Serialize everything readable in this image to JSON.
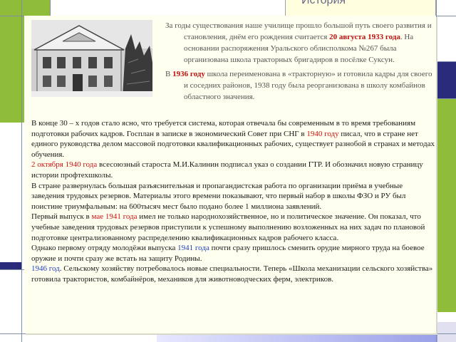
{
  "header": {
    "title": "История"
  },
  "intro": {
    "p1": {
      "t1": "За годы существования наше училище прошло большой путь своего развития и становления, днём его рождения считается ",
      "date": "20 августа 1933 года",
      "t2": ". На основании распоряжения Уральского облисполкома №267 была организована школа тракторных бригадиров в посёлке Суксун."
    },
    "p2": {
      "t1": "В ",
      "year": "1936 году",
      "t2": " школа переименована в «тракторную» и готовила кадры для своего и соседних районов, 1938 году была реорганизована в школу комбайнов областного значения."
    }
  },
  "body": {
    "p1": {
      "t1": "В конце 30 – х годов стало ясно, что требуется система, которая отвечала бы современным в то время требованиям подготовки рабочих кадров. Госплан в записке в экономический Совет при СНГ в ",
      "year": "1940 году",
      "t2": " писал, что в стране нет единого руководства делом массовой подготовки квалификационных рабочих, существует разнобой в странах и методах обучения."
    },
    "p2": {
      "date": "2 октября 1940 года",
      "t1": " всесоюзный  староста М.И.Калинин подписал указ о создании ГТР. И обозначил новую страницу истории профтехшколы."
    },
    "p3": "В стране развернулась большая разъяснительная и пропагандистская работа по организации приёма в учебные заведения трудовых резервов. Материалы этого времени показывают, что первый набор в школы ФЗО и РУ был поистине триумфальным: на 600тысяч мест было подано более 1 миллиона заявлений.",
    "p4": {
      "t1": "Первый выпуск в ",
      "date": "мае 1941 года",
      "t2": " имел не только народнохозяйственное, но и политическое значение. Он показал, что учебные заведения трудовых резервов приступили к успешному выполнению возложенных на них задач по плановой подготовке централизованному распределению квалификационных кадров рабочего класса."
    },
    "p5": {
      "t1": "Однако первому отряду молодёжи выпуска ",
      "year": "1941 года",
      "t2": " почти сразу пришлось сменить орудие мирного труда на боевое оружие и почти сразу же встать на защиту Родины."
    },
    "p6": {
      "year": "1946 год",
      "t1": ". Сельскому хозяйству потребовалось новые специальности. Теперь «Школа механизации сельского хозяйства» готовила трактористов, комбайнёров, механиков для животноводческих ферм, электриков."
    }
  },
  "colors": {
    "accent_red": "#d01010",
    "accent_blue": "#2040c0",
    "frame_green": "#8fbd3a",
    "frame_navy": "#2a2a7a"
  }
}
